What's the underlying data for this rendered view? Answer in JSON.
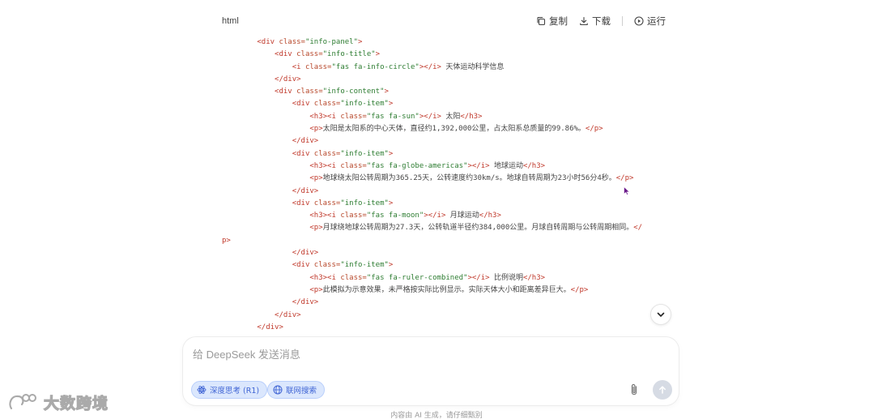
{
  "code_block": {
    "language": "html",
    "actions": {
      "copy": "复制",
      "download": "下载",
      "run": "运行"
    },
    "lines": [
      {
        "indent": "        ",
        "tokens": [
          [
            "tag",
            "<div "
          ],
          [
            "attr",
            "class="
          ],
          [
            "str",
            "\"info-panel\""
          ],
          [
            "tag",
            ">"
          ]
        ]
      },
      {
        "indent": "            ",
        "tokens": [
          [
            "tag",
            "<div "
          ],
          [
            "attr",
            "class="
          ],
          [
            "str",
            "\"info-title\""
          ],
          [
            "tag",
            ">"
          ]
        ]
      },
      {
        "indent": "                ",
        "tokens": [
          [
            "tag",
            "<i "
          ],
          [
            "attr",
            "class="
          ],
          [
            "str",
            "\"fas fa-info-circle\""
          ],
          [
            "tag",
            "></i>"
          ],
          [
            "text",
            " 天体运动科学信息"
          ]
        ]
      },
      {
        "indent": "            ",
        "tokens": [
          [
            "tag",
            "</div>"
          ]
        ]
      },
      {
        "indent": "            ",
        "tokens": [
          [
            "tag",
            "<div "
          ],
          [
            "attr",
            "class="
          ],
          [
            "str",
            "\"info-content\""
          ],
          [
            "tag",
            ">"
          ]
        ]
      },
      {
        "indent": "                ",
        "tokens": [
          [
            "tag",
            "<div "
          ],
          [
            "attr",
            "class="
          ],
          [
            "str",
            "\"info-item\""
          ],
          [
            "tag",
            ">"
          ]
        ]
      },
      {
        "indent": "                    ",
        "tokens": [
          [
            "tag",
            "<h3><i "
          ],
          [
            "attr",
            "class="
          ],
          [
            "str",
            "\"fas fa-sun\""
          ],
          [
            "tag",
            "></i>"
          ],
          [
            "text",
            " 太阳"
          ],
          [
            "tag",
            "</h3>"
          ]
        ]
      },
      {
        "indent": "                    ",
        "tokens": [
          [
            "tag",
            "<p>"
          ],
          [
            "text",
            "太阳是太阳系的中心天体，直径约1,392,000公里，占太阳系总质量的99.86%。"
          ],
          [
            "tag",
            "</p>"
          ]
        ]
      },
      {
        "indent": "                ",
        "tokens": [
          [
            "tag",
            "</div>"
          ]
        ]
      },
      {
        "indent": "                ",
        "tokens": [
          [
            "tag",
            "<div "
          ],
          [
            "attr",
            "class="
          ],
          [
            "str",
            "\"info-item\""
          ],
          [
            "tag",
            ">"
          ]
        ]
      },
      {
        "indent": "                    ",
        "tokens": [
          [
            "tag",
            "<h3><i "
          ],
          [
            "attr",
            "class="
          ],
          [
            "str",
            "\"fas fa-globe-americas\""
          ],
          [
            "tag",
            "></i>"
          ],
          [
            "text",
            " 地球运动"
          ],
          [
            "tag",
            "</h3>"
          ]
        ]
      },
      {
        "indent": "                    ",
        "tokens": [
          [
            "tag",
            "<p>"
          ],
          [
            "text",
            "地球绕太阳公转周期为365.25天，公转速度约30km/s。地球自转周期为23小时56分4秒。"
          ],
          [
            "tag",
            "</p>"
          ]
        ]
      },
      {
        "indent": "                ",
        "tokens": [
          [
            "tag",
            "</div>"
          ]
        ]
      },
      {
        "indent": "                ",
        "tokens": [
          [
            "tag",
            "<div "
          ],
          [
            "attr",
            "class="
          ],
          [
            "str",
            "\"info-item\""
          ],
          [
            "tag",
            ">"
          ]
        ]
      },
      {
        "indent": "                    ",
        "tokens": [
          [
            "tag",
            "<h3><i "
          ],
          [
            "attr",
            "class="
          ],
          [
            "str",
            "\"fas fa-moon\""
          ],
          [
            "tag",
            "></i>"
          ],
          [
            "text",
            " 月球运动"
          ],
          [
            "tag",
            "</h3>"
          ]
        ]
      },
      {
        "indent": "                    ",
        "tokens": [
          [
            "tag",
            "<p>"
          ],
          [
            "text",
            "月球绕地球公转周期为27.3天，公转轨道半径约384,000公里。月球自转周期与公转周期相同。"
          ],
          [
            "tag",
            "</"
          ]
        ]
      },
      {
        "indent": "",
        "tokens": [
          [
            "tag",
            "p>"
          ]
        ]
      },
      {
        "indent": "                ",
        "tokens": [
          [
            "tag",
            "</div>"
          ]
        ]
      },
      {
        "indent": "                ",
        "tokens": [
          [
            "tag",
            "<div "
          ],
          [
            "attr",
            "class="
          ],
          [
            "str",
            "\"info-item\""
          ],
          [
            "tag",
            ">"
          ]
        ]
      },
      {
        "indent": "                    ",
        "tokens": [
          [
            "tag",
            "<h3><i "
          ],
          [
            "attr",
            "class="
          ],
          [
            "str",
            "\"fas fa-ruler-combined\""
          ],
          [
            "tag",
            "></i>"
          ],
          [
            "text",
            " 比例说明"
          ],
          [
            "tag",
            "</h3>"
          ]
        ]
      },
      {
        "indent": "                    ",
        "tokens": [
          [
            "tag",
            "<p>"
          ],
          [
            "text",
            "此模拟为示意效果，未严格按实际比例显示。实际天体大小和距离差异巨大。"
          ],
          [
            "tag",
            "</p>"
          ]
        ]
      },
      {
        "indent": "                ",
        "tokens": [
          [
            "tag",
            "</div>"
          ]
        ]
      },
      {
        "indent": "            ",
        "tokens": [
          [
            "tag",
            "</div>"
          ]
        ]
      },
      {
        "indent": "        ",
        "tokens": [
          [
            "tag",
            "</div>"
          ]
        ]
      }
    ]
  },
  "composer": {
    "placeholder": "给 DeepSeek 发送消息",
    "deep_think_label": "深度思考 (R1)",
    "search_label": "联网搜索"
  },
  "footer_note": "内容由 AI 生成，请仔细甄别",
  "watermark": "大数跨境",
  "colors": {
    "chip_bg": "#dbe7fd",
    "chip_text": "#4166d5",
    "send_disabled": "#d6dbe4"
  }
}
